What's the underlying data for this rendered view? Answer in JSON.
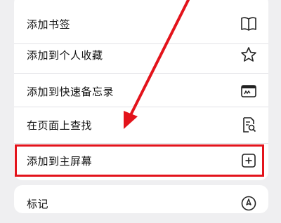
{
  "menu": {
    "items": [
      {
        "label": "添加书签",
        "icon": "book-icon"
      },
      {
        "label": "添加到个人收藏",
        "icon": "star-icon"
      },
      {
        "label": "添加到快速备忘录",
        "icon": "quick-note-icon"
      },
      {
        "label": "在页面上查找",
        "icon": "find-in-page-icon"
      },
      {
        "label": "添加到主屏幕",
        "icon": "add-square-icon"
      }
    ],
    "second_group": [
      {
        "label": "标记",
        "icon": "markup-icon"
      }
    ]
  },
  "annotation": {
    "color": "#e3131b",
    "highlighted_item": "添加到主屏幕"
  }
}
